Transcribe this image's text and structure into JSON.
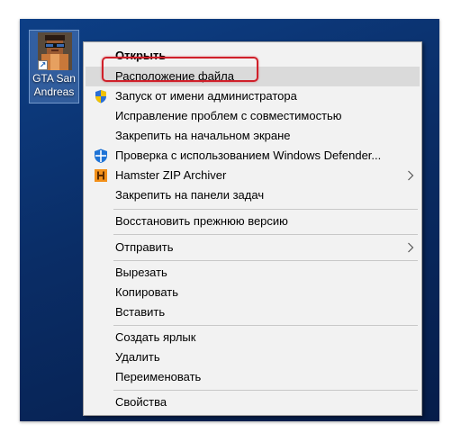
{
  "desktop_icon": {
    "label_line1": "GTA San",
    "label_line2": "Andreas",
    "shortcut_glyph": "↗"
  },
  "menu": {
    "open": "Открыть",
    "file_location": "Расположение файла",
    "run_as_admin": "Запуск от имени администратора",
    "troubleshoot": "Исправление проблем с совместимостью",
    "pin_start": "Закрепить на начальном экране",
    "defender_scan": "Проверка с использованием Windows Defender...",
    "hamster_zip": "Hamster ZIP Archiver",
    "pin_taskbar": "Закрепить на панели задач",
    "restore_previous": "Восстановить прежнюю версию",
    "send_to": "Отправить",
    "cut": "Вырезать",
    "copy": "Копировать",
    "paste": "Вставить",
    "create_shortcut": "Создать ярлык",
    "delete": "Удалить",
    "rename": "Переименовать",
    "properties": "Свойства"
  },
  "icons": {
    "admin": "uac-shield-icon",
    "defender": "windows-defender-icon",
    "hamster": "hamster-zip-icon",
    "submenu": "chevron-right-icon"
  },
  "colors": {
    "desktop": "#0a2d66",
    "menu_bg": "#f2f2f2",
    "highlight": "#dadada",
    "callout": "#d0202a",
    "hamster": "#f39019",
    "defender": "#1e73d6"
  }
}
